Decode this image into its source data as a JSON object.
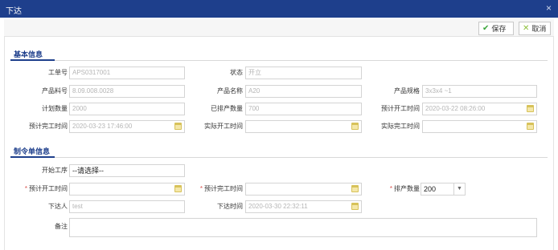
{
  "dialog": {
    "title": "下达",
    "close_label": "×"
  },
  "toolbar": {
    "save_label": "保存",
    "cancel_label": "取消"
  },
  "basic": {
    "title": "基本信息",
    "fields": {
      "work_order": {
        "label": "工单号",
        "value": "APS0317001"
      },
      "status": {
        "label": "状态",
        "value": "开立"
      },
      "part_no": {
        "label": "产品料号",
        "value": "8.09.008.0028"
      },
      "part_name": {
        "label": "产品名称",
        "value": "A20"
      },
      "spec": {
        "label": "产品规格",
        "value": "3x3x4 ~1"
      },
      "plan_qty": {
        "label": "计划数量",
        "value": "2000"
      },
      "scheduled_qty": {
        "label": "已排产数量",
        "value": "700"
      },
      "est_start": {
        "label": "预计开工时间",
        "value": "2020-03-22 08:26:00"
      },
      "est_finish": {
        "label": "预计完工时间",
        "value": "2020-03-23 17:46:00"
      },
      "act_start": {
        "label": "实际开工时间",
        "value": ""
      },
      "act_finish": {
        "label": "实际完工时间",
        "value": ""
      }
    }
  },
  "order": {
    "title": "制令单信息",
    "required_mark": "*",
    "fields": {
      "start_process": {
        "label": "开始工序",
        "value": "--请选择--"
      },
      "est_start": {
        "label": "预计开工时间",
        "value": ""
      },
      "est_finish": {
        "label": "预计完工时间",
        "value": ""
      },
      "sched_qty": {
        "label": "排产数量",
        "value": "200"
      },
      "issuer": {
        "label": "下达人",
        "value": "test"
      },
      "issue_time": {
        "label": "下达时间",
        "value": "2020-03-30 22:32:11"
      },
      "remark": {
        "label": "备注",
        "value": ""
      }
    }
  }
}
